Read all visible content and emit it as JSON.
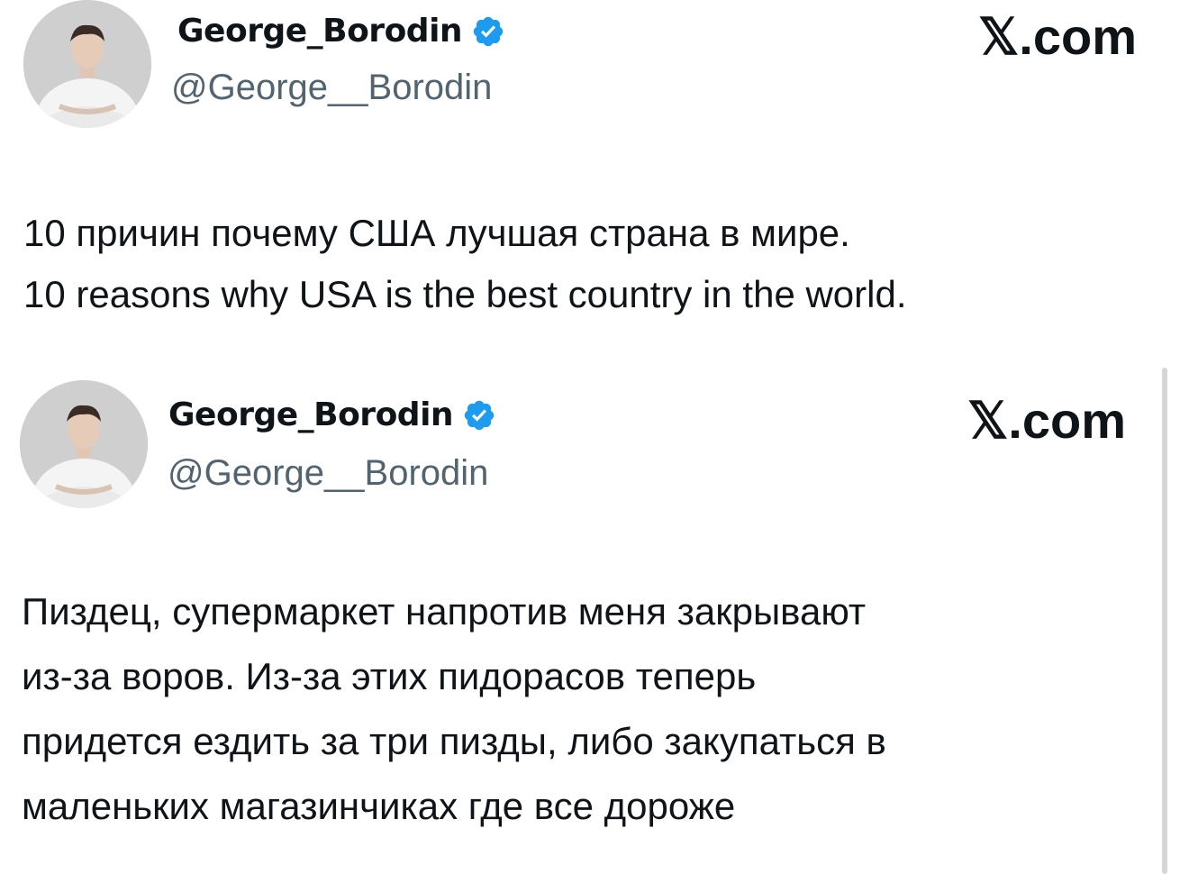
{
  "posts": [
    {
      "author": {
        "display_name": "George_Borodin",
        "handle": "@George__Borodin",
        "verified": true,
        "avatar": "person-photo-avatar"
      },
      "site": "𝕏.com",
      "site_icon": "x-logo-icon",
      "text_lines": [
        "10 причин почему США лучшая страна в мире.",
        "10 reasons why USA is the best country in the world."
      ]
    },
    {
      "author": {
        "display_name": "George_Borodin",
        "handle": "@George__Borodin",
        "verified": true,
        "avatar": "person-photo-avatar"
      },
      "site": "𝕏.com",
      "site_icon": "x-logo-icon",
      "text_lines": [
        "Пиздец, супермаркет напротив меня закрывают",
        "из-за воров. Из-за этих пидорасов теперь",
        "придется ездить за три пизды, либо закупаться в",
        "маленьких магазинчиках где все дороже"
      ]
    }
  ],
  "colors": {
    "text": "#0f1419",
    "secondary_text": "#536471",
    "verified_badge": "#1d9bf0",
    "background": "#ffffff"
  }
}
